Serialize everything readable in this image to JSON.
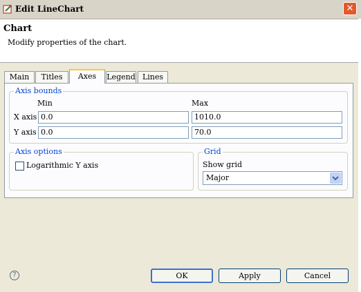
{
  "window": {
    "title": "Edit LineChart",
    "close_icon": "close-icon"
  },
  "header": {
    "title": "Chart",
    "description": "Modify properties of the chart."
  },
  "tabs": [
    {
      "label": "Main",
      "active": false
    },
    {
      "label": "Titles",
      "active": false
    },
    {
      "label": "Axes",
      "active": true
    },
    {
      "label": "Legend",
      "active": false
    },
    {
      "label": "Lines",
      "active": false
    }
  ],
  "axis_bounds": {
    "title": "Axis bounds",
    "min_header": "Min",
    "max_header": "Max",
    "x_label": "X axis",
    "y_label": "Y axis",
    "x_min": "0.0",
    "x_max": "1010.0",
    "y_min": "0.0",
    "y_max": "70.0"
  },
  "axis_options": {
    "title": "Axis options",
    "log_y_label": "Logarithmic Y axis",
    "log_y_checked": false
  },
  "grid": {
    "title": "Grid",
    "show_grid_label": "Show grid",
    "selected": "Major"
  },
  "buttons": {
    "ok": "OK",
    "apply": "Apply",
    "cancel": "Cancel"
  },
  "colors": {
    "group_title": "#0046d5",
    "active_tab_accent": "#ffc83c",
    "close_button": "#e25a2c"
  }
}
